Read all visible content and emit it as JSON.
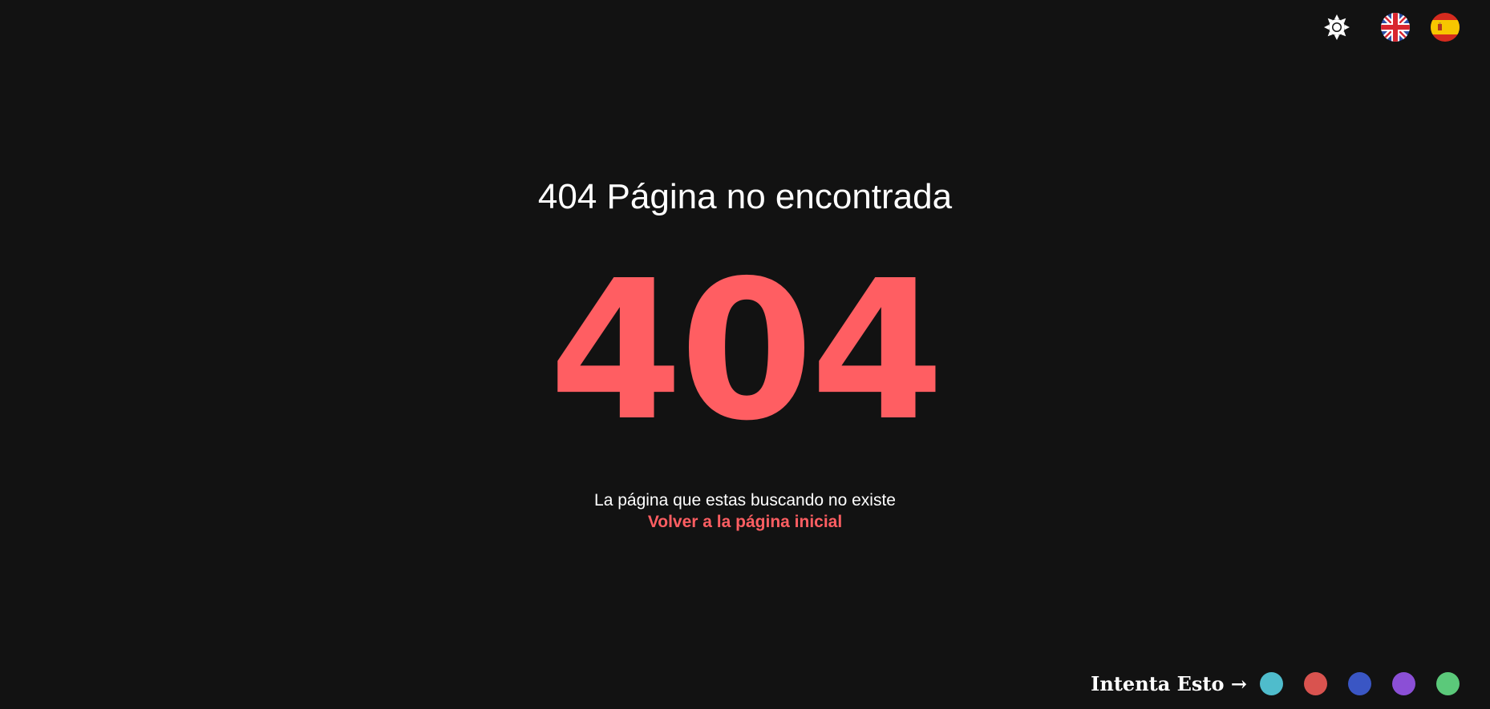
{
  "header": {
    "theme_toggle_icon": "sun-icon",
    "languages": [
      {
        "code": "en",
        "icon": "uk-flag-icon"
      },
      {
        "code": "es",
        "icon": "spain-flag-icon"
      }
    ]
  },
  "main": {
    "title": "404 Página no encontrada",
    "code": "404",
    "message": "La página que estas buscando no existe",
    "home_link": "Volver a la página inicial"
  },
  "color_picker": {
    "label": "Intenta Esto →",
    "swatches": [
      "#4fbccc",
      "#d9534f",
      "#3a56c4",
      "#8b4fd6",
      "#5bc97a"
    ]
  },
  "colors": {
    "background": "#121212",
    "accent": "#ff5e62",
    "text": "#ffffff"
  }
}
